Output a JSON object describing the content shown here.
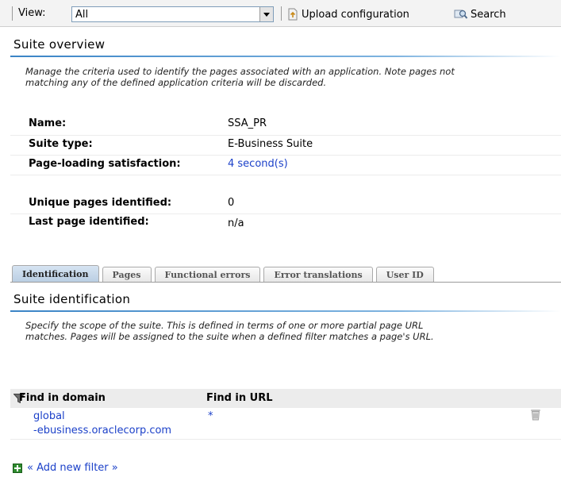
{
  "toolbar": {
    "view_label": "View:",
    "view_value": "All",
    "upload_label": "Upload configuration",
    "search_label": "Search"
  },
  "overview": {
    "title": "Suite overview",
    "description_line1": "Manage the criteria used to identify the pages associated with an application. Note pages not",
    "description_line2": "matching any of the defined application criteria will be discarded.",
    "fields": [
      {
        "label": "Name:",
        "value": "SSA_PR"
      },
      {
        "label": "Suite type:",
        "value": "E-Business Suite"
      },
      {
        "label": "Page-loading satisfaction:",
        "value": "4 second(s)"
      },
      {
        "label": "Unique pages identified:",
        "value": "0"
      },
      {
        "label": "Last page identified:",
        "value": "n/a"
      }
    ]
  },
  "tabs": [
    {
      "label": "Identification",
      "active": true
    },
    {
      "label": "Pages",
      "active": false
    },
    {
      "label": "Functional errors",
      "active": false
    },
    {
      "label": "Error translations",
      "active": false
    },
    {
      "label": "User ID",
      "active": false
    }
  ],
  "identification": {
    "title": "Suite identification",
    "description_line1": "Specify the scope of the suite. This is defined in terms of one or more partial page URL",
    "description_line2": "matches. Pages will be assigned to the suite when a defined filter matches a page's URL.",
    "columns": [
      "Find in domain",
      "Find in URL"
    ],
    "rows": [
      {
        "domain_line1": "global",
        "domain_line2": "-ebusiness.oraclecorp.com",
        "url": "*"
      }
    ],
    "add_filter_label": "« Add new filter »"
  },
  "colors": {
    "link": "#1c41c9",
    "accent_rule": "#3a84c6",
    "tab_active": "#c6d8ea"
  },
  "icons": [
    "upload-icon",
    "search-icon",
    "filter-icon",
    "trash-icon",
    "add-icon",
    "chevron-down-icon"
  ]
}
